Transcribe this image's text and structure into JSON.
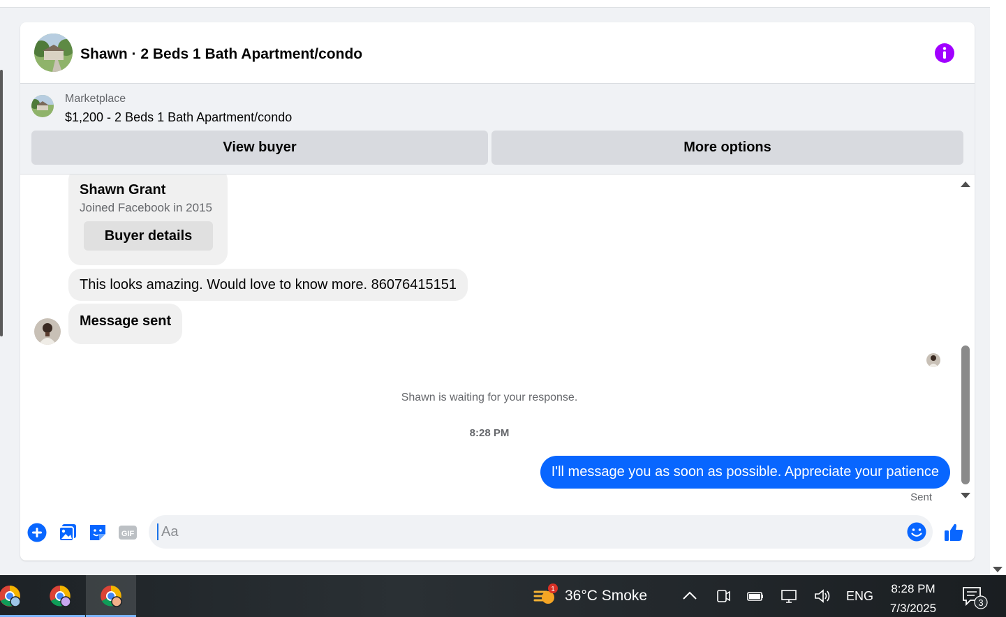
{
  "conversation": {
    "title": "Shawn · 2 Beds 1 Bath Apartment/condo"
  },
  "listing": {
    "source": "Marketplace",
    "price_title": "$1,200 - 2 Beds 1 Bath Apartment/condo",
    "view_buyer_label": "View buyer",
    "more_options_label": "More options"
  },
  "buyer_card": {
    "name": "Shawn Grant",
    "joined": "Joined Facebook in 2015",
    "details_label": "Buyer details"
  },
  "messages": {
    "incoming_1": "This looks amazing. Would love to know more. 86076415151",
    "incoming_2": "Message sent",
    "waiting_note": "Shawn is waiting for your response.",
    "timestamp": "8:28 PM",
    "outgoing_1": "I'll message you as soon as possible. Appreciate your patience",
    "status": "Sent"
  },
  "composer": {
    "placeholder": "Aa",
    "gif_label": "GIF"
  },
  "taskbar": {
    "weather_badge": "1",
    "weather": "36°C  Smoke",
    "language": "ENG",
    "time": "8:28 PM",
    "date": "7/3/2025",
    "notification_count": "3"
  },
  "colors": {
    "accent": "#0866ff",
    "info_purple": "#a100ff",
    "bubble_incoming": "#f0f0f0",
    "listing_bg": "#f0f2f5"
  },
  "icons": [
    "info-icon",
    "add-circle-icon",
    "photo-icon",
    "sticker-icon",
    "gif-icon",
    "emoji-icon",
    "thumbs-up-icon",
    "chevron-up-icon",
    "wifi-icon",
    "volume-icon",
    "battery-icon",
    "notification-icon"
  ]
}
